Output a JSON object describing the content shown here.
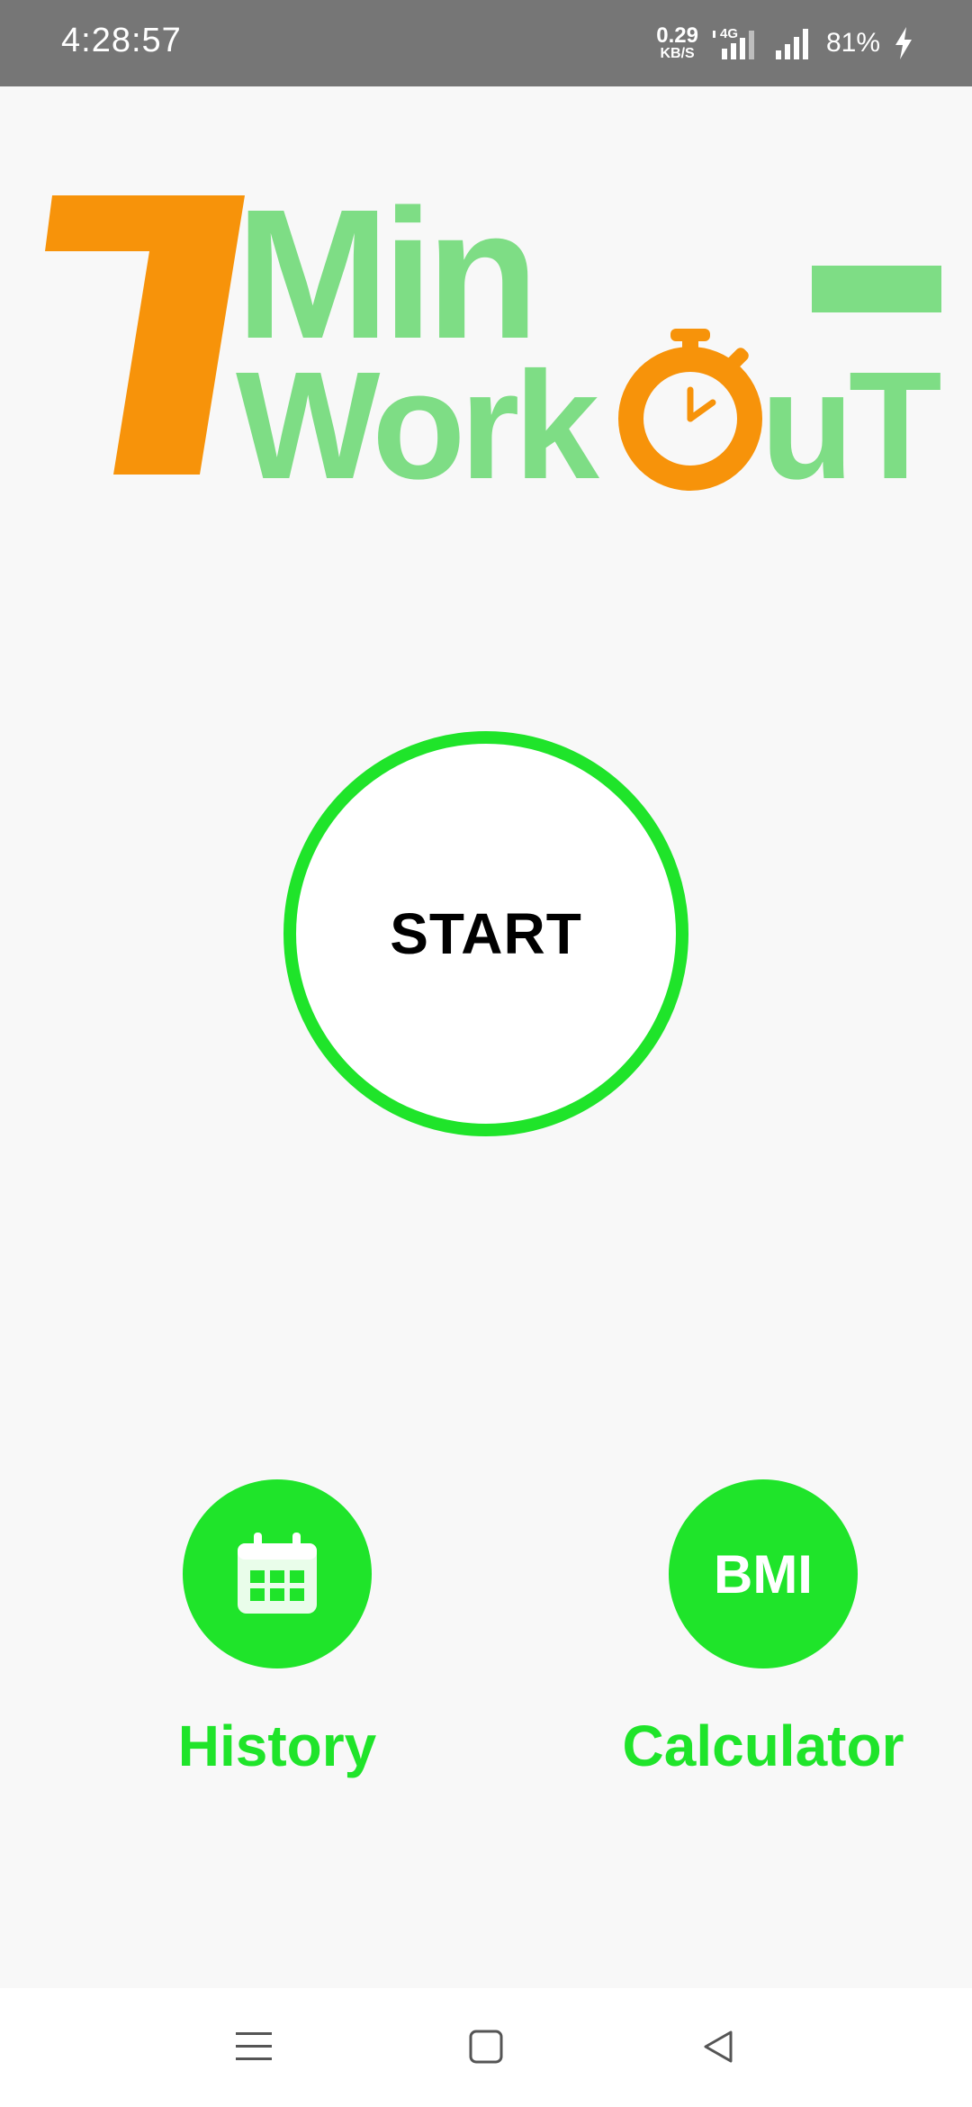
{
  "status_bar": {
    "time": "4:28:57",
    "net_speed_value": "0.29",
    "net_speed_unit": "KB/S",
    "network_type": "4G",
    "battery": "81%"
  },
  "logo": {
    "number": "7",
    "line1": "Min",
    "line2_prefix": "Work",
    "line2_suffix": "uT",
    "colors": {
      "orange": "#f7930a",
      "green": "#7edd85"
    }
  },
  "main": {
    "start_label": "START"
  },
  "actions": {
    "history": {
      "icon": "calendar-icon",
      "label": "History"
    },
    "bmi": {
      "icon_text": "BMI",
      "label": "Calculator"
    }
  },
  "nav": {
    "menu_icon": "menu-icon",
    "home_icon": "home-icon",
    "back_icon": "back-icon"
  },
  "colors": {
    "accent": "#1fe42a",
    "status_bar": "#767676",
    "background": "#f8f8f8"
  }
}
